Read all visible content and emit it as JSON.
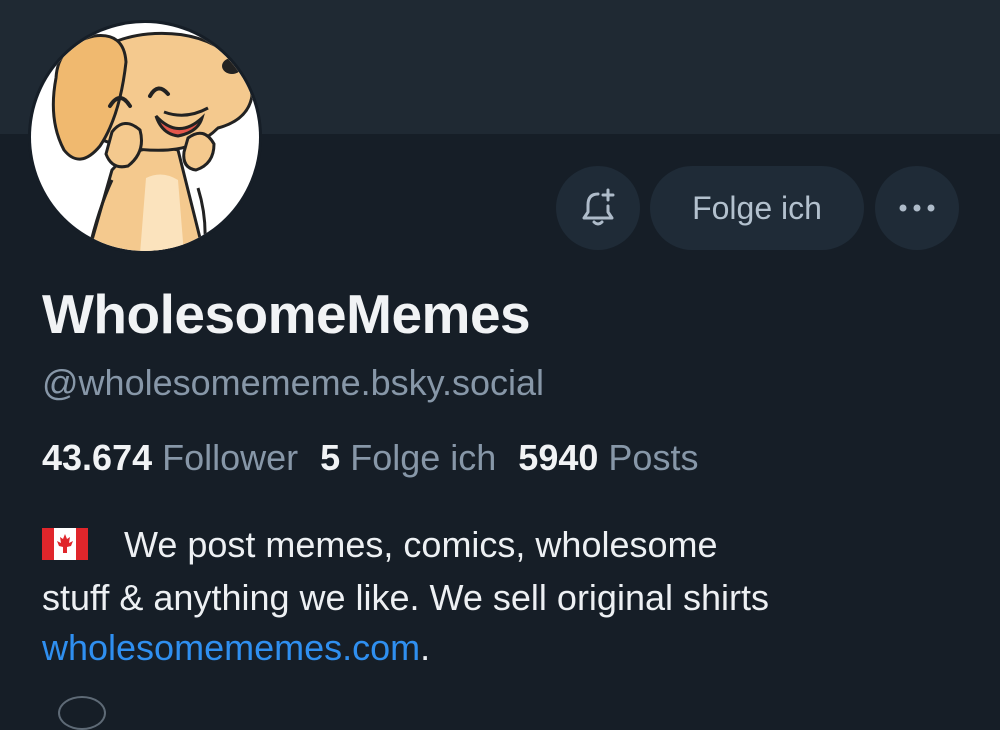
{
  "profile": {
    "display_name": "WholesomeMemes",
    "handle": "@wholesomememe.bsky.social",
    "avatar_icon": "cartoon-dog-avatar"
  },
  "actions": {
    "notify_icon": "bell-plus-icon",
    "follow_label": "Folge ich",
    "more_icon": "ellipsis-icon"
  },
  "stats": {
    "followers_count": "43.674",
    "followers_label": "Follower",
    "following_count": "5",
    "following_label": "Folge ich",
    "posts_count": "5940",
    "posts_label": "Posts"
  },
  "bio": {
    "flag_icon": "canada-flag-icon",
    "line1": "We post memes, comics, wholesome",
    "line2": "stuff & anything we like. We sell original shirts",
    "link_text": "wholesomememes.com",
    "trailing": "."
  },
  "colors": {
    "background": "#161e27",
    "banner": "#1f2933",
    "button": "#1f2b37",
    "link": "#2f8ff0",
    "muted_text": "#8797a8"
  }
}
